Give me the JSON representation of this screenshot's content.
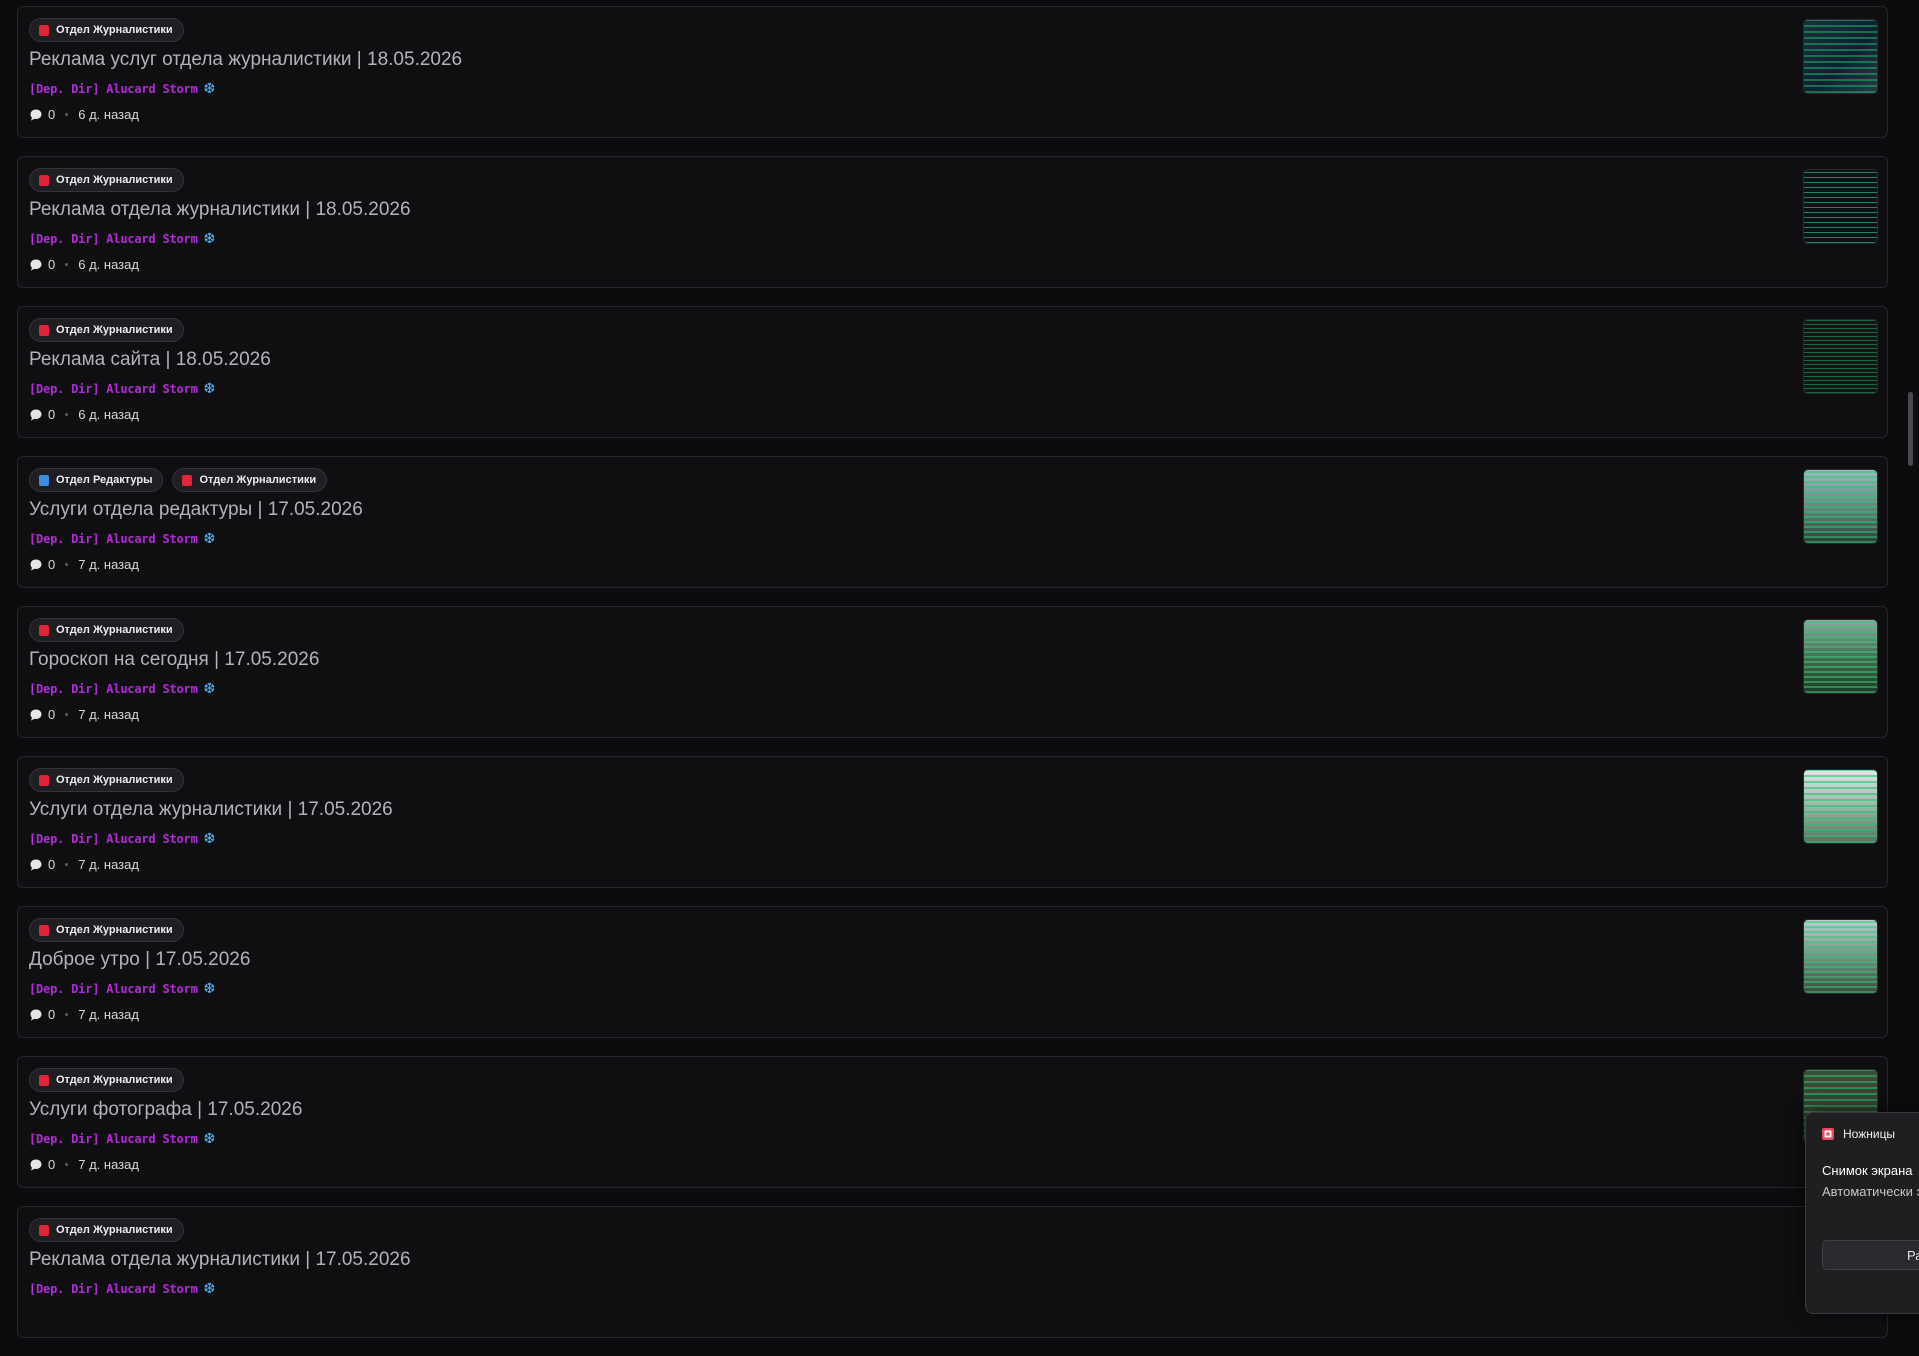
{
  "colors": {
    "journalism_tag": "#e0243a",
    "editing_tag": "#3b8fe0",
    "author": "#b02ad6",
    "snowflake": "#55aef0"
  },
  "posts": [
    {
      "tags": [
        {
          "label": "Отдел Журналистики",
          "color": "#e0243a"
        }
      ],
      "title": "Реклама услуг отдела журналистики | 18.05.2026",
      "author": "[Dep. Dir] Alucard Storm",
      "author_icon": "snowflake-icon",
      "comments": "0",
      "time": "6 д. назад",
      "thumb": "t1"
    },
    {
      "tags": [
        {
          "label": "Отдел Журналистики",
          "color": "#e0243a"
        }
      ],
      "title": "Реклама отдела журналистики | 18.05.2026",
      "author": "[Dep. Dir] Alucard Storm",
      "author_icon": "snowflake-icon",
      "comments": "0",
      "time": "6 д. назад",
      "thumb": "t2"
    },
    {
      "tags": [
        {
          "label": "Отдел Журналистики",
          "color": "#e0243a"
        }
      ],
      "title": "Реклама сайта | 18.05.2026",
      "author": "[Dep. Dir] Alucard Storm",
      "author_icon": "snowflake-icon",
      "comments": "0",
      "time": "6 д. назад",
      "thumb": "t3"
    },
    {
      "tags": [
        {
          "label": "Отдел Редактуры",
          "color": "#3b8fe0"
        },
        {
          "label": "Отдел Журналистики",
          "color": "#e0243a"
        }
      ],
      "title": "Услуги отдела редактуры | 17.05.2026",
      "author": "[Dep. Dir] Alucard Storm",
      "author_icon": "snowflake-icon",
      "comments": "0",
      "time": "7 д. назад",
      "thumb": "t4"
    },
    {
      "tags": [
        {
          "label": "Отдел Журналистики",
          "color": "#e0243a"
        }
      ],
      "title": "Гороскоп на сегодня | 17.05.2026",
      "author": "[Dep. Dir] Alucard Storm",
      "author_icon": "snowflake-icon",
      "comments": "0",
      "time": "7 д. назад",
      "thumb": "t5"
    },
    {
      "tags": [
        {
          "label": "Отдел Журналистики",
          "color": "#e0243a"
        }
      ],
      "title": "Услуги отдела журналистики | 17.05.2026",
      "author": "[Dep. Dir] Alucard Storm",
      "author_icon": "snowflake-icon",
      "comments": "0",
      "time": "7 д. назад",
      "thumb": "t6"
    },
    {
      "tags": [
        {
          "label": "Отдел Журналистики",
          "color": "#e0243a"
        }
      ],
      "title": "Доброе утро | 17.05.2026",
      "author": "[Dep. Dir] Alucard Storm",
      "author_icon": "snowflake-icon",
      "comments": "0",
      "time": "7 д. назад",
      "thumb": "t7"
    },
    {
      "tags": [
        {
          "label": "Отдел Журналистики",
          "color": "#e0243a"
        }
      ],
      "title": "Услуги фотографа | 17.05.2026",
      "author": "[Dep. Dir] Alucard Storm",
      "author_icon": "snowflake-icon",
      "comments": "0",
      "time": "7 д. назад",
      "thumb": "t8"
    },
    {
      "tags": [
        {
          "label": "Отдел Журналистики",
          "color": "#e0243a"
        }
      ],
      "title": "Реклама отдела журналистики | 17.05.2026",
      "author": "[Dep. Dir] Alucard Storm",
      "author_icon": "snowflake-icon",
      "comments": "",
      "time": "",
      "thumb": ""
    }
  ],
  "toast": {
    "app_name": "Ножницы",
    "app_icon": "snipping-tool-icon",
    "title": "Снимок экрана",
    "text": "Автоматически экрана.",
    "button_label": "Ра"
  }
}
